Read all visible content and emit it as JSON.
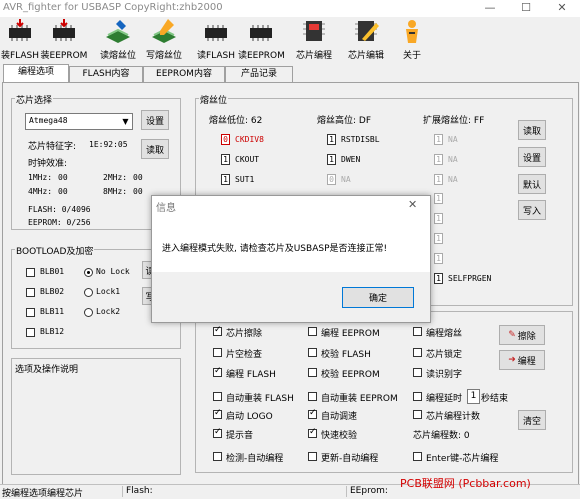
{
  "window": {
    "title": "AVR_fighter for USBASP CopyRight:zhb2000",
    "minimize": "—",
    "maximize": "☐",
    "close": "✕"
  },
  "toolbar": {
    "items": [
      {
        "label": "装FLASH",
        "icon": "chip-load-icon"
      },
      {
        "label": "装EEPROM",
        "icon": "chip-load-icon"
      },
      {
        "label": "读熔丝位",
        "icon": "read-fuse-icon"
      },
      {
        "label": "写熔丝位",
        "icon": "write-fuse-icon"
      },
      {
        "label": "读FLASH",
        "icon": "chip-read-icon"
      },
      {
        "label": "读EEPROM",
        "icon": "chip-read-icon"
      },
      {
        "label": "芯片编程",
        "icon": "program-icon"
      },
      {
        "label": "芯片编辑",
        "icon": "edit-icon"
      },
      {
        "label": "关于",
        "icon": "about-icon"
      }
    ]
  },
  "tabs": [
    "编程选项",
    "FLASH内容",
    "EEPROM内容",
    "产品记录"
  ],
  "chip_select": {
    "legend": "芯片选择",
    "selected": "Atmega48",
    "set_button": "设置",
    "read_button": "读取",
    "signature_label": "芯片特征字:",
    "signature_value": "1E:92:05",
    "calib_label": "时钟效准:",
    "calib": [
      {
        "label": "1MHz:",
        "value": "00"
      },
      {
        "label": "2MHz:",
        "value": "00"
      },
      {
        "label": "4MHz:",
        "value": "00"
      },
      {
        "label": "8MHz:",
        "value": "00"
      }
    ],
    "flash": "FLASH: 0/4096",
    "eeprom": "EEPROM: 0/256"
  },
  "bootload": {
    "legend": "BOOTLOAD及加密",
    "items": [
      "BLB01",
      "BLB02",
      "BLB11",
      "BLB12"
    ],
    "radios": [
      "No Lock",
      "Lock1",
      "Lock2"
    ],
    "read_button": "读",
    "write_button": "写"
  },
  "notes": {
    "legend": "选项及操作说明"
  },
  "fuses": {
    "legend": "熔丝位",
    "low_label": "熔丝低位: 62",
    "high_label": "熔丝高位: DF",
    "ext_label": "扩展熔丝位: FF",
    "low": [
      {
        "bit": "0",
        "name": "CKDIV8"
      },
      {
        "bit": "1",
        "name": "CKOUT"
      },
      {
        "bit": "1",
        "name": "SUT1"
      }
    ],
    "high": [
      {
        "bit": "1",
        "name": "RSTDISBL"
      },
      {
        "bit": "1",
        "name": "DWEN"
      },
      {
        "bit": "0",
        "name": "NA"
      }
    ],
    "ext": [
      {
        "bit": "1",
        "name": "NA"
      },
      {
        "bit": "1",
        "name": "NA"
      },
      {
        "bit": "1",
        "name": "NA"
      }
    ],
    "ext_lower_bits": [
      "1",
      "1",
      "1",
      "1"
    ],
    "selfprgen": {
      "bit": "1",
      "name": "SELFPRGEN"
    },
    "buttons": [
      "读取",
      "设置",
      "默认",
      "写入"
    ]
  },
  "options": {
    "col1": [
      {
        "label": "芯片擦除",
        "checked": true
      },
      {
        "label": "片空检查",
        "checked": false
      },
      {
        "label": "编程 FLASH",
        "checked": true
      },
      {
        "label": "自动重装 FLASH",
        "checked": false
      },
      {
        "label": "启动 LOGO",
        "checked": true
      },
      {
        "label": "提示音",
        "checked": true
      },
      {
        "label": "检测-自动编程",
        "checked": false
      }
    ],
    "col2": [
      {
        "label": "编程 EEPROM",
        "checked": false
      },
      {
        "label": "校验 FLASH",
        "checked": false
      },
      {
        "label": "校验 EEPROM",
        "checked": false
      },
      {
        "label": "自动重装 EEPROM",
        "checked": false
      },
      {
        "label": "自动调速",
        "checked": true
      },
      {
        "label": "快速校验",
        "checked": true
      },
      {
        "label": "更新-自动编程",
        "checked": false
      }
    ],
    "col3": [
      {
        "label": "编程熔丝",
        "checked": false
      },
      {
        "label": "芯片锁定",
        "checked": false
      },
      {
        "label": "读识别字",
        "checked": false
      },
      {
        "label": "编程延时",
        "checked": false
      },
      {
        "label": "芯片编程计数",
        "checked": false
      }
    ],
    "delay_value": "1",
    "delay_suffix": "秒结束",
    "count_label": "芯片编程数: 0",
    "enter_option": "Enter键-芯片编程",
    "erase_button": "擦除",
    "program_button": "编程",
    "clear_button": "清空"
  },
  "dialog": {
    "title": "信息",
    "message": "进入编程模式失败, 请检查芯片及USBASP是否连接正常!",
    "ok": "确定",
    "close": "✕"
  },
  "status": {
    "left": "按编程选项编程芯片",
    "flash": "Flash:",
    "eeprom": "EEprom:"
  },
  "watermark": "PCB联盟网 (Pcbbar.com)",
  "colors": {
    "watermark": "#d40000",
    "accent": "#0078d7"
  }
}
